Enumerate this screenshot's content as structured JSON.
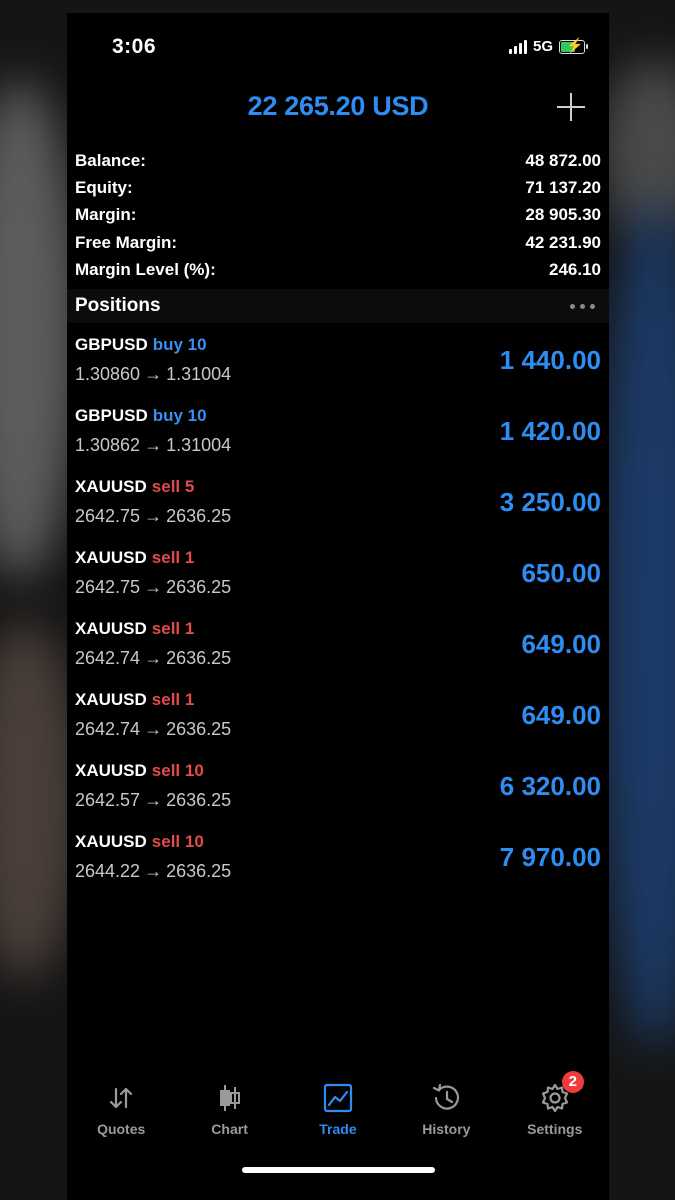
{
  "status_bar": {
    "time": "3:06",
    "network": "5G"
  },
  "header": {
    "title": "22 265.20 USD"
  },
  "summary": [
    {
      "label": "Balance:",
      "value": "48 872.00"
    },
    {
      "label": "Equity:",
      "value": "71 137.20"
    },
    {
      "label": "Margin:",
      "value": "28 905.30"
    },
    {
      "label": "Free Margin:",
      "value": "42 231.90"
    },
    {
      "label": "Margin Level (%):",
      "value": "246.10"
    }
  ],
  "positions_section": {
    "title": "Positions"
  },
  "positions": [
    {
      "symbol": "GBPUSD",
      "side": "buy 10",
      "direction": "buy",
      "open": "1.30860",
      "current": "1.31004",
      "profit": "1 440.00"
    },
    {
      "symbol": "GBPUSD",
      "side": "buy 10",
      "direction": "buy",
      "open": "1.30862",
      "current": "1.31004",
      "profit": "1 420.00"
    },
    {
      "symbol": "XAUUSD",
      "side": "sell 5",
      "direction": "sell",
      "open": "2642.75",
      "current": "2636.25",
      "profit": "3 250.00"
    },
    {
      "symbol": "XAUUSD",
      "side": "sell 1",
      "direction": "sell",
      "open": "2642.75",
      "current": "2636.25",
      "profit": "650.00"
    },
    {
      "symbol": "XAUUSD",
      "side": "sell 1",
      "direction": "sell",
      "open": "2642.74",
      "current": "2636.25",
      "profit": "649.00"
    },
    {
      "symbol": "XAUUSD",
      "side": "sell 1",
      "direction": "sell",
      "open": "2642.74",
      "current": "2636.25",
      "profit": "649.00"
    },
    {
      "symbol": "XAUUSD",
      "side": "sell 10",
      "direction": "sell",
      "open": "2642.57",
      "current": "2636.25",
      "profit": "6 320.00"
    },
    {
      "symbol": "XAUUSD",
      "side": "sell 10",
      "direction": "sell",
      "open": "2644.22",
      "current": "2636.25",
      "profit": "7 970.00"
    }
  ],
  "arrow_glyph": "→",
  "tabs": [
    {
      "label": "Quotes",
      "icon": "quotes-icon",
      "active": false
    },
    {
      "label": "Chart",
      "icon": "chart-icon",
      "active": false
    },
    {
      "label": "Trade",
      "icon": "trade-icon",
      "active": true
    },
    {
      "label": "History",
      "icon": "history-icon",
      "active": false
    },
    {
      "label": "Settings",
      "icon": "settings-icon",
      "active": false,
      "badge": "2"
    }
  ],
  "colors": {
    "accent": "#2f8cf0",
    "buy": "#3b8fee",
    "sell": "#e24b4b",
    "badge": "#ee3b3b",
    "battery": "#31c95a"
  }
}
